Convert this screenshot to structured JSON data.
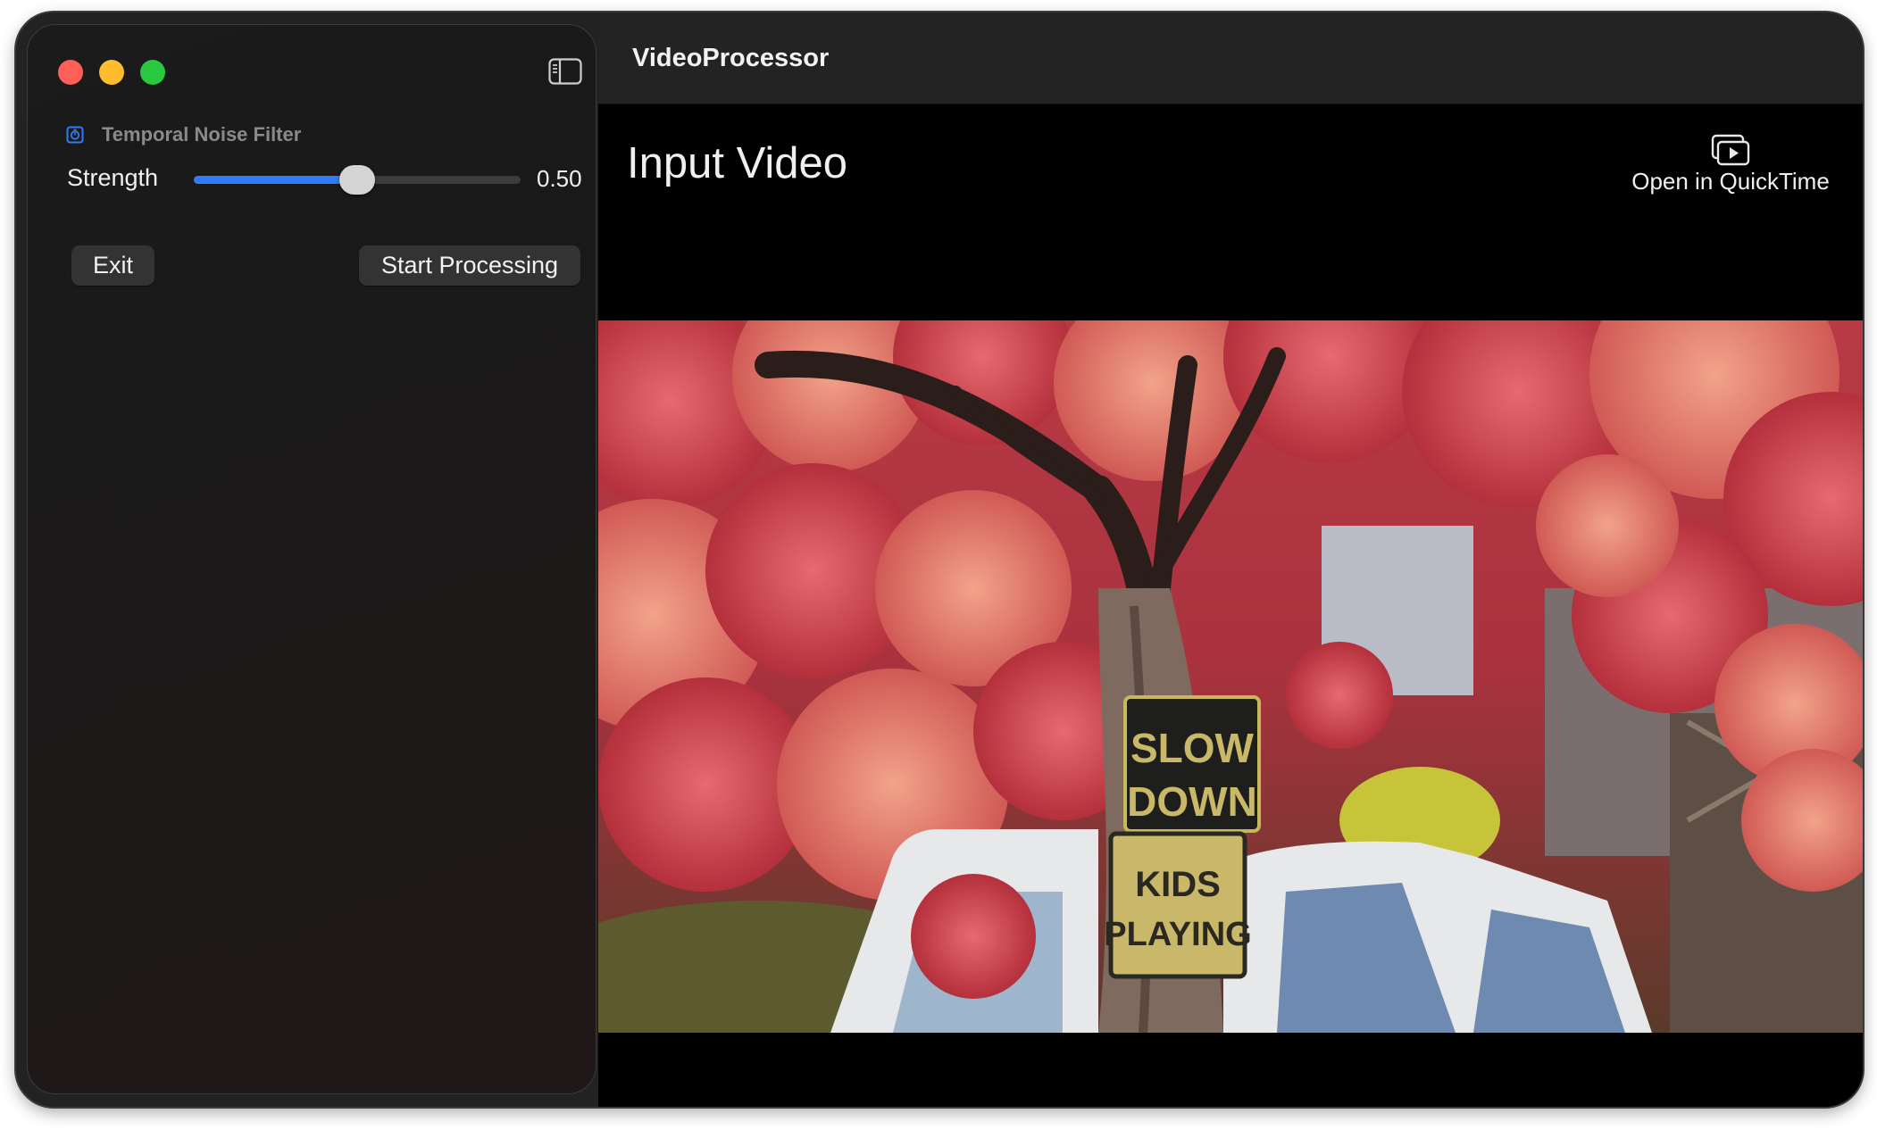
{
  "window": {
    "title": "VideoProcessor",
    "traffic_lights": [
      {
        "name": "close",
        "color": "#fe5f57"
      },
      {
        "name": "minimize",
        "color": "#febc2e"
      },
      {
        "name": "zoom",
        "color": "#28c840"
      }
    ],
    "sidebar_toggle_icon": "sidebar-left-icon"
  },
  "sidebar": {
    "filter": {
      "icon": "noise-filter-icon",
      "title": "Temporal Noise Filter"
    },
    "strength": {
      "label": "Strength",
      "value": 0.5,
      "value_text": "0.50",
      "accent_color": "#2f7cf6"
    },
    "buttons": {
      "exit_label": "Exit",
      "start_label": "Start Processing"
    }
  },
  "main": {
    "section_title": "Input Video",
    "quicktime": {
      "icon": "play-in-window-icon",
      "label": "Open in QuickTime"
    },
    "video": {
      "sign_line1": "SLOW",
      "sign_line2": "DOWN",
      "sign_line3": "KIDS",
      "sign_line4": "PLAYING"
    }
  }
}
